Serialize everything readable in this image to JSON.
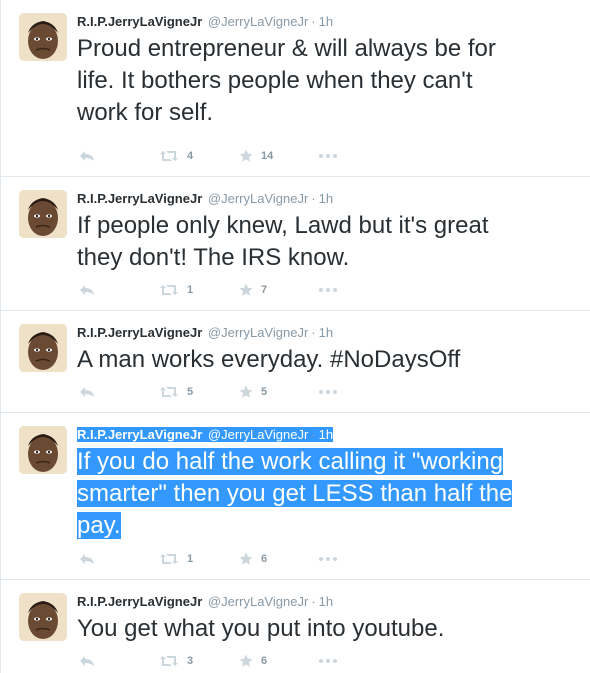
{
  "tweets": [
    {
      "fullname": "R.I.P.JerryLaVigneJr",
      "username": "@JerryLaVigneJr",
      "separator": "·",
      "time": "1h",
      "text_lines": [
        "Proud entrepreneur & will always be for",
        "life. It bothers people when they can't",
        "work for self."
      ],
      "retweets": "4",
      "favorites": "14"
    },
    {
      "fullname": "R.I.P.JerryLaVigneJr",
      "username": "@JerryLaVigneJr",
      "separator": "·",
      "time": "1h",
      "text_lines": [
        "If people only knew, Lawd but it's great",
        "they don't! The IRS know."
      ],
      "retweets": "1",
      "favorites": "7"
    },
    {
      "fullname": "R.I.P.JerryLaVigneJr",
      "username": "@JerryLaVigneJr",
      "separator": "·",
      "time": "1h",
      "text_lines": [
        "A man works everyday. #NoDaysOff"
      ],
      "retweets": "5",
      "favorites": "5"
    },
    {
      "fullname": "R.I.P.JerryLaVigneJr",
      "username": "@JerryLaVigneJr",
      "separator": "·",
      "time": "1h",
      "text_lines": [
        "If you do half the work calling it \"working",
        "smarter\" then you get LESS than half the",
        "pay."
      ],
      "retweets": "1",
      "favorites": "6",
      "selected": true
    },
    {
      "fullname": "R.I.P.JerryLaVigneJr",
      "username": "@JerryLaVigneJr",
      "separator": "·",
      "time": "1h",
      "text_lines": [
        "You get what you put into youtube."
      ],
      "retweets": "3",
      "favorites": "6"
    }
  ],
  "icons": {
    "reply": "reply-icon",
    "retweet": "retweet-icon",
    "favorite": "star-icon",
    "more": "more-dots-icon"
  },
  "colors": {
    "text": "#292f33",
    "meta": "#8899a6",
    "icon": "#ccd6dd",
    "selection": "#3399ff",
    "border": "#e1e8ed"
  }
}
